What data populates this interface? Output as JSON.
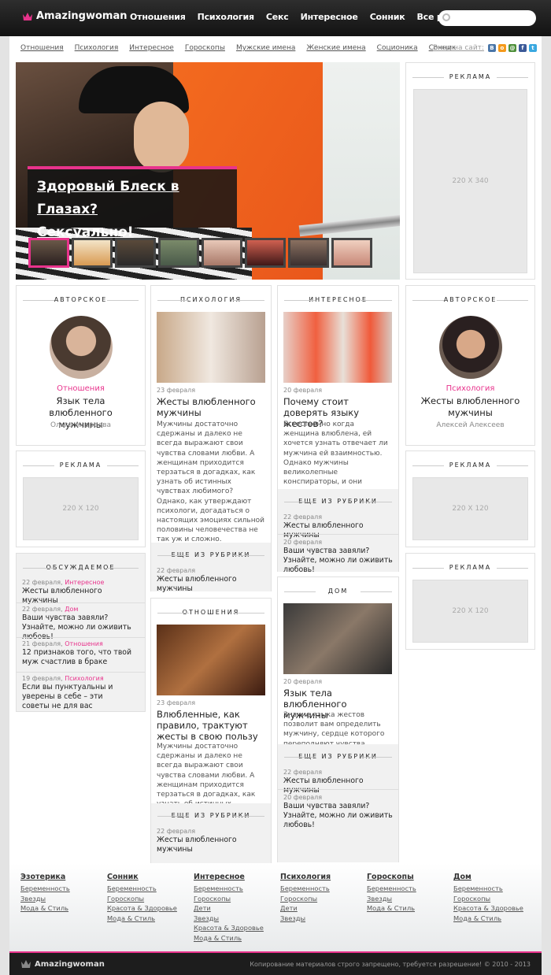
{
  "header": {
    "logo": "Amazingwoman",
    "nav": [
      "Отношения",
      "Психология",
      "Секс",
      "Интересное",
      "Сонник",
      "Все разделы"
    ],
    "search_placeholder": ""
  },
  "subnav": [
    "Отношения",
    "Психология",
    "Интересное",
    "Гороскопы",
    "Мужские имена",
    "Женские имена",
    "Соционика",
    "Сонник"
  ],
  "login": {
    "label": "Вход на сайт:",
    "networks": [
      "vk-icon",
      "odnoklassniki-icon",
      "mailru-icon",
      "facebook-icon",
      "twitter-icon"
    ]
  },
  "hero": {
    "title_line1": "Здоровый Блеск в Глазах?",
    "title_line2": "Сексуально!"
  },
  "ads": {
    "title": "РЕКЛАМА",
    "size_big": "220 X 340",
    "size_small": "220 X 120"
  },
  "col1": {
    "header": "АВТОРСКОЕ",
    "category": "Отношения",
    "title": "Язык тела влюбленного мужчины",
    "author": "Ольга Андреева"
  },
  "discussed": {
    "header": "ОБСУЖДАЕМОЕ",
    "items": [
      {
        "date": "22 февраля,",
        "cat": "Интересное",
        "title": "Жесты влюбленного мужчины"
      },
      {
        "date": "22 февраля,",
        "cat": "Дом",
        "title": "Ваши чувства завяли? Узнайте, можно ли оживить любовь!"
      },
      {
        "date": "21 февраля,",
        "cat": "Отношения",
        "title": "12 признаков того, что твой муж счастлив в браке"
      },
      {
        "date": "19 февраля,",
        "cat": "Психология",
        "title": "Если вы пунктуальны и уверены в себе – эти советы не для вас"
      }
    ]
  },
  "col2": {
    "header": "ПСИХОЛОГИЯ",
    "date": "23 февраля",
    "title": "Жесты влюбленного мужчины",
    "text": "Мужчины достаточно сдержаны и далеко не всегда выражают свои чувства словами любви. А женщинам приходится терзаться в догадках, как узнать об истинных чувствах любимого? Однако, как утверждают психологи, догадаться о настоящих эмоциях сильной половины человечества не так уж и сложно. Достаточно обратить внимание на жесты влюбленного мужчины.",
    "more_header": "ЕЩЕ ИЗ РУБРИКИ",
    "more": [
      {
        "date": "22 февраля",
        "title": "Жесты влюбленного мужчины"
      }
    ]
  },
  "col2b": {
    "header": "ОТНОШЕНИЯ",
    "date": "23 февраля",
    "title": "Влюбленные, как правило, трактуют жесты в свою пользу",
    "text": "Мужчины достаточно сдержаны и далеко не всегда выражают свои чувства словами любви. А женщинам приходится терзаться в догадках, как узнать об истинных чувствах любимого?",
    "more_header": "ЕЩЕ ИЗ РУБРИКИ",
    "more": [
      {
        "date": "22 февраля",
        "title": "Жесты влюбленного мужчины"
      }
    ]
  },
  "col3": {
    "header": "ИНТЕРЕСНОЕ",
    "date": "20 февраля",
    "title": "Почему стоит доверять языку жестов?",
    "text": "Естественно когда женщина влюблена, ей хочется узнать отвечает ли мужчина ей взаимностью. Однако мужчины великолепные конспираторы, и они отлично маскируют свои подлинные чувства.",
    "more_header": "ЕЩЕ ИЗ РУБРИКИ",
    "more": [
      {
        "date": "22 февраля",
        "title": "Жесты влюбленного мужчины"
      },
      {
        "date": "20 февраля",
        "title": "Ваши чувства завяли? Узнайте, можно ли оживить любовь!"
      }
    ]
  },
  "col3b": {
    "header": "ДОМ",
    "date": "20 февраля",
    "title": "Язык тела влюбленного мужчины",
    "text": "Знание языка жестов позволит вам определить мужчину, сердце которого переполняют чувства",
    "more_header": "ЕЩЕ ИЗ РУБРИКИ",
    "more": [
      {
        "date": "22 февраля",
        "title": "Жесты влюбленного мужчины"
      },
      {
        "date": "20 февраля",
        "title": "Ваши чувства завяли? Узнайте, можно ли оживить любовь!"
      }
    ]
  },
  "col4": {
    "header": "АВТОРСКОЕ",
    "category": "Психология",
    "title": "Жесты влюбленного мужчины",
    "author": "Алексей Алексеев"
  },
  "footer": {
    "cols": [
      {
        "title": "Эзотерика",
        "items": [
          "Беременность",
          "Звезды",
          "Мода & Стиль"
        ]
      },
      {
        "title": "Сонник",
        "items": [
          "Беременность",
          "Гороскопы",
          "Красота & Здоровье",
          "Мода & Стиль"
        ]
      },
      {
        "title": "Интересное",
        "items": [
          "Беременность",
          "Гороскопы",
          "Дети",
          "Звезды",
          "Красота & Здоровье",
          "Мода & Стиль"
        ]
      },
      {
        "title": "Психология",
        "items": [
          "Беременность",
          "Гороскопы",
          "Дети",
          "Звезды"
        ]
      },
      {
        "title": "Гороскопы",
        "items": [
          "Беременность",
          "Звезды",
          "Мода & Стиль"
        ]
      },
      {
        "title": "Дом",
        "items": [
          "Беременность",
          "Гороскопы",
          "Красота & Здоровье",
          "Мода & Стиль"
        ]
      }
    ],
    "logo": "Amazingwoman",
    "copyright": "Копирование материалов строго запрещено, требуется разрешение! © 2010 - 2013"
  },
  "colors": {
    "accent": "#e8338c",
    "topbar": "#1a1a1a"
  }
}
